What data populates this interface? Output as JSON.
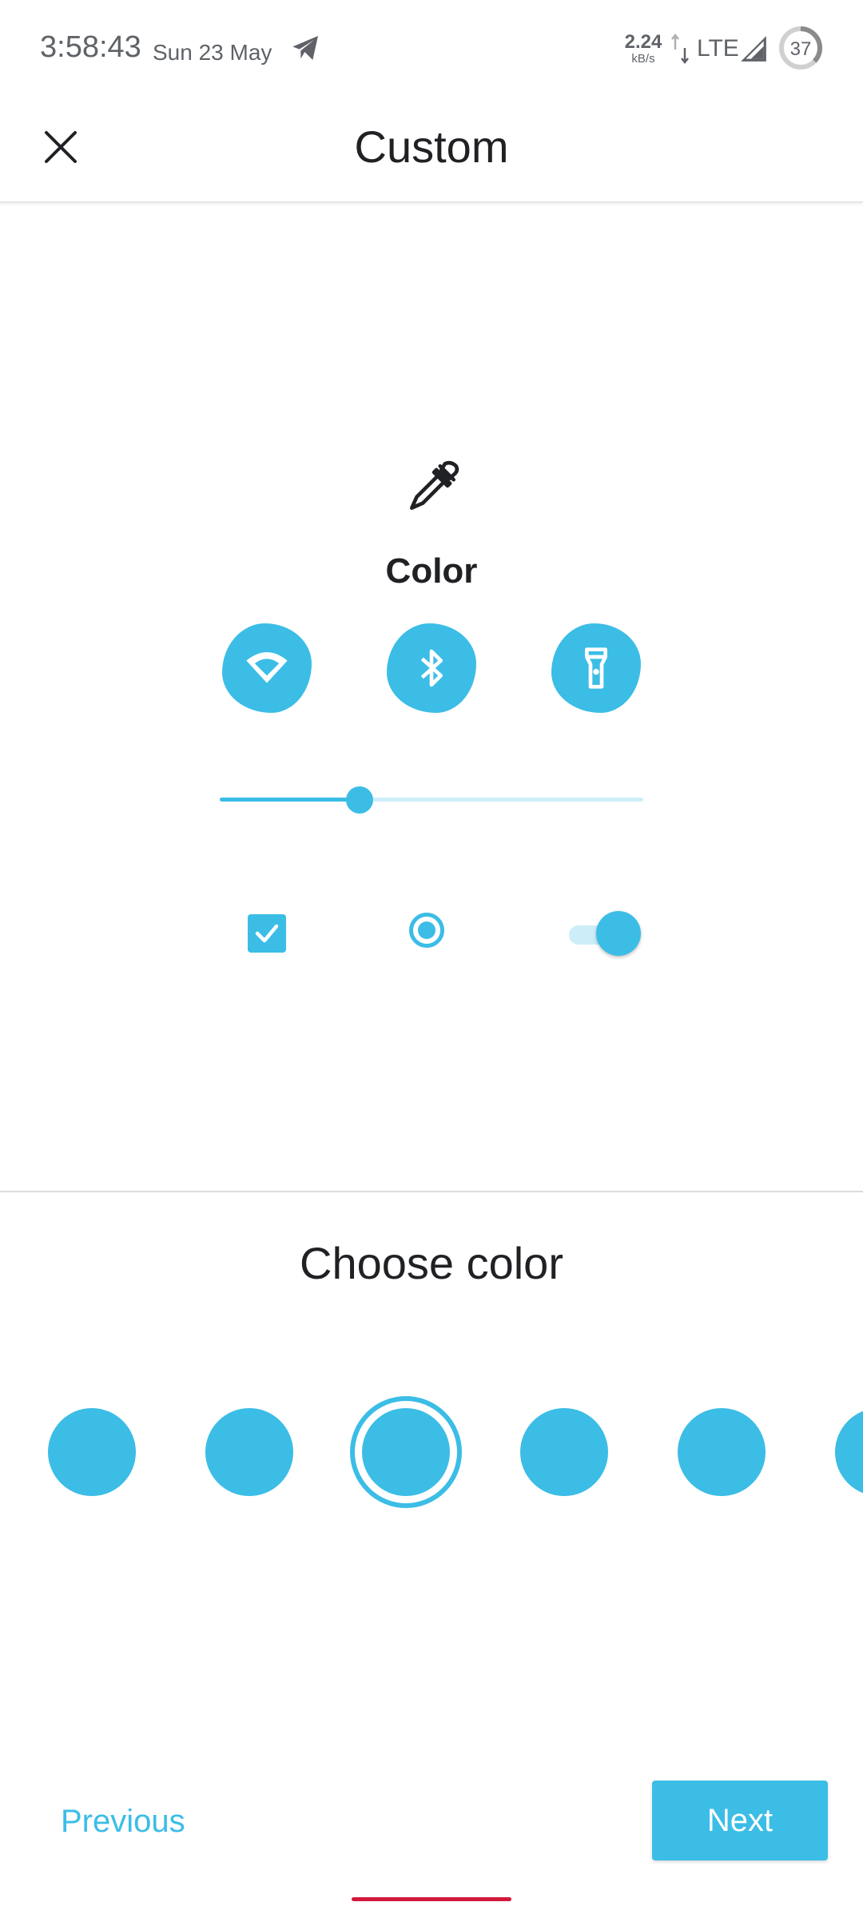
{
  "status_bar": {
    "time": "3:58:43",
    "date": "Sun 23 May",
    "net_speed": "2.24",
    "net_unit": "kB/s",
    "network": "LTE",
    "battery": "37"
  },
  "app_bar": {
    "title": "Custom",
    "close_icon": "close-icon"
  },
  "preview": {
    "icon": "eyedropper-icon",
    "label": "Color",
    "tiles": [
      "wifi-icon",
      "bluetooth-icon",
      "flashlight-icon"
    ],
    "slider_value": 0.33,
    "checkbox_checked": true,
    "radio_selected": true,
    "switch_on": true
  },
  "choose": {
    "title": "Choose color",
    "selected_index": 2,
    "swatches": [
      "#3bbde6",
      "#3bbde6",
      "#3bbde6",
      "#3bbde6",
      "#3bbde6",
      "#3bbde6"
    ]
  },
  "footer": {
    "previous_label": "Previous",
    "next_label": "Next"
  },
  "colors": {
    "accent": "#3bbde6",
    "accent_light": "#cdeef9",
    "text": "#202124",
    "nav_indicator": "#d1193b"
  }
}
